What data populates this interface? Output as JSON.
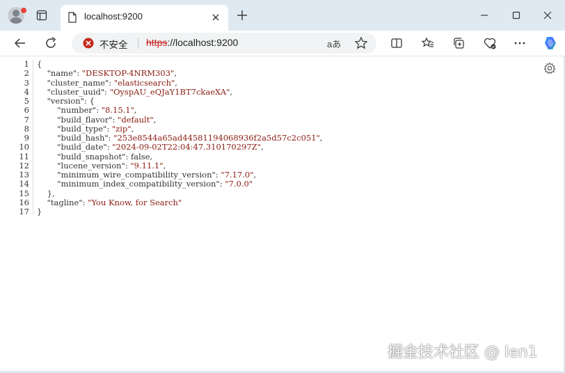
{
  "window": {
    "tab_title": "localhost:9200"
  },
  "address_bar": {
    "security_label": "不安全",
    "url_scheme": "https",
    "url_rest": "://localhost:9200",
    "read_aloud_glyph": "aあ"
  },
  "json_lines": [
    {
      "n": "1",
      "indent": "",
      "parts": [
        {
          "t": "{",
          "c": "p"
        }
      ]
    },
    {
      "n": "2",
      "indent": "    ",
      "parts": [
        {
          "t": "\"name\"",
          "c": "k"
        },
        {
          "t": ": ",
          "c": "p"
        },
        {
          "t": "\"DESKTOP-4NRM303\"",
          "c": "s"
        },
        {
          "t": ",",
          "c": "p"
        }
      ]
    },
    {
      "n": "3",
      "indent": "    ",
      "parts": [
        {
          "t": "\"cluster_name\"",
          "c": "k"
        },
        {
          "t": ": ",
          "c": "p"
        },
        {
          "t": "\"elasticsearch\"",
          "c": "s"
        },
        {
          "t": ",",
          "c": "p"
        }
      ]
    },
    {
      "n": "4",
      "indent": "    ",
      "parts": [
        {
          "t": "\"cluster_uuid\"",
          "c": "k"
        },
        {
          "t": ": ",
          "c": "p"
        },
        {
          "t": "\"OyspAU_eQJaY1BT7ckaeXA\"",
          "c": "s"
        },
        {
          "t": ",",
          "c": "p"
        }
      ]
    },
    {
      "n": "5",
      "indent": "    ",
      "parts": [
        {
          "t": "\"version\"",
          "c": "k"
        },
        {
          "t": ": {",
          "c": "p"
        }
      ]
    },
    {
      "n": "6",
      "indent": "        ",
      "parts": [
        {
          "t": "\"number\"",
          "c": "k"
        },
        {
          "t": ": ",
          "c": "p"
        },
        {
          "t": "\"8.15.1\"",
          "c": "s"
        },
        {
          "t": ",",
          "c": "p"
        }
      ]
    },
    {
      "n": "7",
      "indent": "        ",
      "parts": [
        {
          "t": "\"build_flavor\"",
          "c": "k"
        },
        {
          "t": ": ",
          "c": "p"
        },
        {
          "t": "\"default\"",
          "c": "s"
        },
        {
          "t": ",",
          "c": "p"
        }
      ]
    },
    {
      "n": "8",
      "indent": "        ",
      "parts": [
        {
          "t": "\"build_type\"",
          "c": "k"
        },
        {
          "t": ": ",
          "c": "p"
        },
        {
          "t": "\"zip\"",
          "c": "s"
        },
        {
          "t": ",",
          "c": "p"
        }
      ]
    },
    {
      "n": "9",
      "indent": "        ",
      "parts": [
        {
          "t": "\"build_hash\"",
          "c": "k"
        },
        {
          "t": ": ",
          "c": "p"
        },
        {
          "t": "\"253e8544a65ad44581194068936f2a5d57c2c051\"",
          "c": "s"
        },
        {
          "t": ",",
          "c": "p"
        }
      ]
    },
    {
      "n": "10",
      "indent": "        ",
      "parts": [
        {
          "t": "\"build_date\"",
          "c": "k"
        },
        {
          "t": ": ",
          "c": "p"
        },
        {
          "t": "\"2024-09-02T22:04:47.310170297Z\"",
          "c": "s"
        },
        {
          "t": ",",
          "c": "p"
        }
      ]
    },
    {
      "n": "11",
      "indent": "        ",
      "parts": [
        {
          "t": "\"build_snapshot\"",
          "c": "k"
        },
        {
          "t": ": false,",
          "c": "p"
        }
      ]
    },
    {
      "n": "12",
      "indent": "        ",
      "parts": [
        {
          "t": "\"lucene_version\"",
          "c": "k"
        },
        {
          "t": ": ",
          "c": "p"
        },
        {
          "t": "\"9.11.1\"",
          "c": "s"
        },
        {
          "t": ",",
          "c": "p"
        }
      ]
    },
    {
      "n": "13",
      "indent": "        ",
      "parts": [
        {
          "t": "\"minimum_wire_compatibility_version\"",
          "c": "k"
        },
        {
          "t": ": ",
          "c": "p"
        },
        {
          "t": "\"7.17.0\"",
          "c": "s"
        },
        {
          "t": ",",
          "c": "p"
        }
      ]
    },
    {
      "n": "14",
      "indent": "        ",
      "parts": [
        {
          "t": "\"minimum_index_compatibility_version\"",
          "c": "k"
        },
        {
          "t": ": ",
          "c": "p"
        },
        {
          "t": "\"7.0.0\"",
          "c": "s"
        }
      ]
    },
    {
      "n": "15",
      "indent": "    ",
      "parts": [
        {
          "t": "},",
          "c": "p"
        }
      ]
    },
    {
      "n": "16",
      "indent": "    ",
      "parts": [
        {
          "t": "\"tagline\"",
          "c": "k"
        },
        {
          "t": ": ",
          "c": "p"
        },
        {
          "t": "\"You Know, for Search\"",
          "c": "s"
        }
      ]
    },
    {
      "n": "17",
      "indent": "",
      "parts": [
        {
          "t": "}",
          "c": "p"
        }
      ]
    }
  ],
  "watermark": "掘金技术社区 @ len1",
  "colors": {
    "tab_strip": "#dfe9f1",
    "string_value": "#8b1a10",
    "insecure_red": "#c5221f"
  }
}
